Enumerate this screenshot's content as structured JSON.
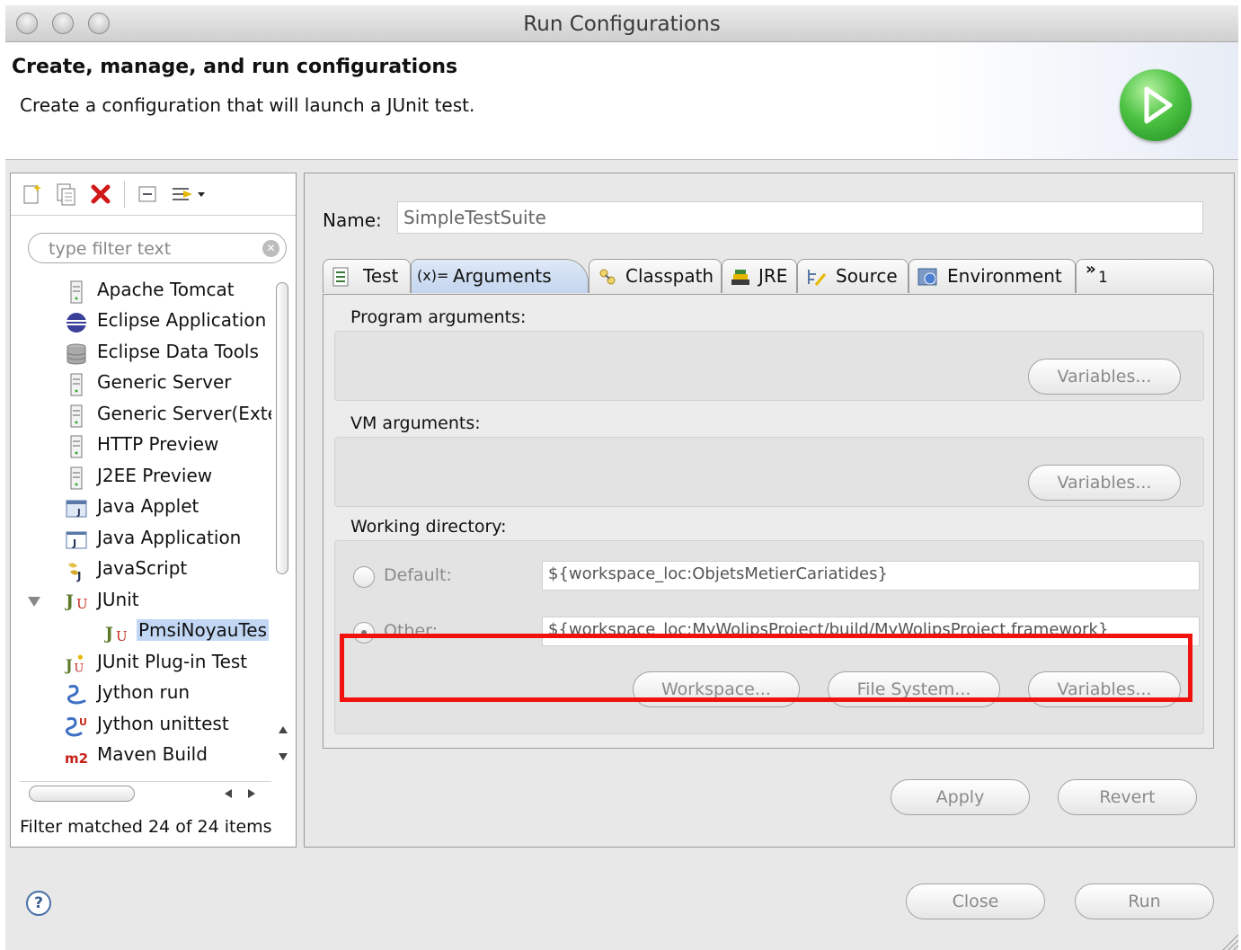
{
  "window": {
    "title": "Run Configurations"
  },
  "header": {
    "title": "Create, manage, and run configurations",
    "subtitle": "Create a configuration that will launch a JUnit test.",
    "icon": "run-launch-icon"
  },
  "left_panel": {
    "toolbar_icons": [
      "new-config-icon",
      "duplicate-icon",
      "delete-icon",
      "collapse-all-icon",
      "filter-icon"
    ],
    "filter": {
      "placeholder": "type filter text"
    },
    "tree": [
      {
        "label": "Apache Tomcat",
        "icon": "server-icon"
      },
      {
        "label": "Eclipse Application",
        "icon": "eclipse-icon"
      },
      {
        "label": "Eclipse Data Tools",
        "icon": "database-icon"
      },
      {
        "label": "Generic Server",
        "icon": "server-icon"
      },
      {
        "label": "Generic Server(Exte",
        "icon": "server-icon"
      },
      {
        "label": "HTTP Preview",
        "icon": "server-icon"
      },
      {
        "label": "J2EE Preview",
        "icon": "server-icon"
      },
      {
        "label": "Java Applet",
        "icon": "java-applet-icon"
      },
      {
        "label": "Java Application",
        "icon": "java-app-icon"
      },
      {
        "label": "JavaScript",
        "icon": "javascript-icon"
      },
      {
        "label": "JUnit",
        "icon": "junit-icon",
        "expanded": true
      },
      {
        "label": "PmsiNoyauTes",
        "icon": "junit-icon",
        "selected": true
      },
      {
        "label": "JUnit Plug-in Test",
        "icon": "junit-plugin-icon"
      },
      {
        "label": "Jython run",
        "icon": "jython-icon"
      },
      {
        "label": "Jython unittest",
        "icon": "jython-unittest-icon"
      },
      {
        "label": "Maven Build",
        "icon": "maven-icon"
      }
    ],
    "status": "Filter matched 24 of 24 items"
  },
  "right_panel": {
    "name_label": "Name:",
    "name_value": "SimpleTestSuite",
    "tabs": [
      {
        "label": "Test",
        "icon": "test-icon"
      },
      {
        "label": "Arguments",
        "icon": "arguments-icon",
        "prefix": "(x)=",
        "active": true
      },
      {
        "label": "Classpath",
        "icon": "classpath-icon"
      },
      {
        "label": "JRE",
        "icon": "jre-icon"
      },
      {
        "label": "Source",
        "icon": "source-icon"
      },
      {
        "label": "Environment",
        "icon": "environment-icon"
      }
    ],
    "overflow_tabs": {
      "marker": "»",
      "count": "1"
    },
    "program_args": {
      "label": "Program arguments:",
      "variables": "Variables..."
    },
    "vm_args": {
      "label": "VM arguments:",
      "variables": "Variables..."
    },
    "working_dir": {
      "label": "Working directory:",
      "default_label": "Default:",
      "default_value": "${workspace_loc:ObjetsMetierCariatides}",
      "other_label": "Other:",
      "other_value": "${workspace_loc:MyWolipsProject/build/MyWolipsProject.framework}",
      "selected": "other",
      "workspace_btn": "Workspace...",
      "filesystem_btn": "File System...",
      "variables_btn": "Variables..."
    },
    "apply": "Apply",
    "revert": "Revert"
  },
  "footer": {
    "help": "?",
    "close": "Close",
    "run": "Run"
  },
  "colors": {
    "highlight": "#f2120d",
    "selection": "#c2d7f4",
    "run_green": "#4cc242"
  }
}
